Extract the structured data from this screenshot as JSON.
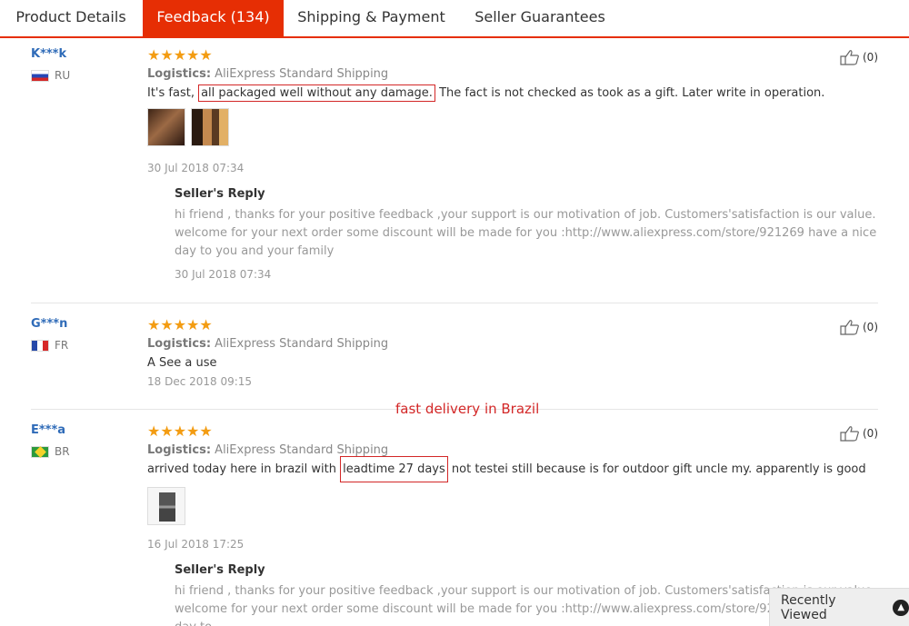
{
  "tabs": [
    {
      "label": "Product Details"
    },
    {
      "label": "Feedback (134)"
    },
    {
      "label": "Shipping & Payment"
    },
    {
      "label": "Seller Guarantees"
    }
  ],
  "colors": {
    "accent": "#e62e04",
    "user": "#2f6bb8",
    "stars": "#f39c12",
    "highlight": "#d32727"
  },
  "reviews": [
    {
      "user": "K***k",
      "country": "RU",
      "stars": "★★★★★",
      "logistics_label": "Logistics:",
      "logistics": "AliExpress Standard Shipping",
      "text_before": "It's fast, ",
      "text_boxed": "all packaged well without any damage.",
      "text_after": " The fact is not checked as took as a gift. Later write in operation.",
      "date": "30 Jul 2018 07:34",
      "likes": "(0)",
      "reply": {
        "title": "Seller's Reply",
        "text": "hi friend , thanks for your positive feedback ,your support is our motivation of job. Customers'satisfaction is our value. welcome for your next order some discount will be made for you :http://www.aliexpress.com/store/921269 have a nice day to you and your family",
        "date": "30 Jul 2018 07:34"
      }
    },
    {
      "user": "G***n",
      "country": "FR",
      "stars": "★★★★★",
      "logistics_label": "Logistics:",
      "logistics": "AliExpress Standard Shipping",
      "text": "A See a use",
      "date": "18 Dec 2018 09:15",
      "likes": "(0)"
    },
    {
      "user": "E***a",
      "country": "BR",
      "stars": "★★★★★",
      "logistics_label": "Logistics:",
      "logistics": "AliExpress Standard Shipping",
      "text_before": "arrived today here in brazil with ",
      "text_boxed": "leadtime 27 days",
      "text_after": " not testei still because is for outdoor gift uncle my. apparently is good",
      "date": "16 Jul 2018 17:25",
      "likes": "(0)",
      "reply": {
        "title": "Seller's Reply",
        "text": "hi friend , thanks for your positive feedback ,your support is our motivation of job. Customers'satisfaction is our value. welcome for your next order some discount will be made for you :http://www.aliexpress.com/store/921269 have a nice day to"
      }
    }
  ],
  "annotation": "fast delivery in Brazil",
  "recently_viewed": {
    "label": "Recently Viewed",
    "icon": "chevron-up-icon"
  }
}
